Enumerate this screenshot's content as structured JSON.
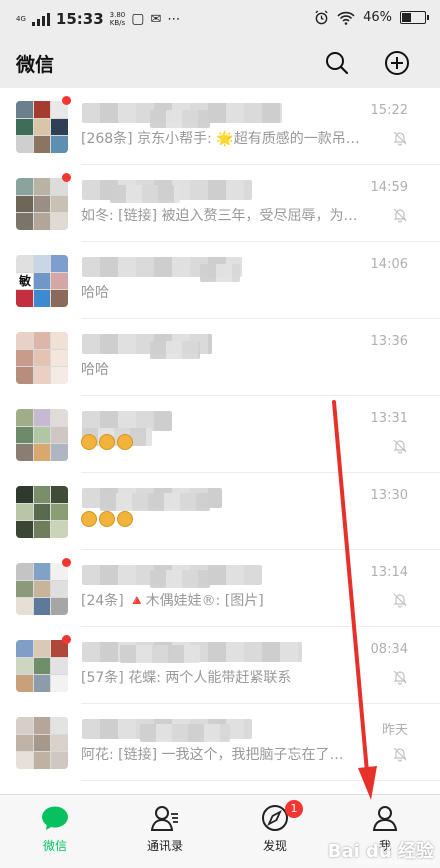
{
  "status_bar": {
    "network": "4G",
    "time": "15:33",
    "speed_value": "3.80",
    "speed_unit": "KB/s",
    "battery": "46%",
    "battery_level": 0.46
  },
  "header": {
    "title": "微信",
    "search_icon": "search-icon",
    "add_icon": "plus-circle-icon"
  },
  "chats": [
    {
      "time": "15:22",
      "preview": "[268条] 京东小帮手: 🌟超有质感的一款吊带…",
      "muted": true,
      "dot": true,
      "avatar_colors": [
        "#6b7f8f",
        "#a63c2f",
        "#e8e8e8",
        "#3e6e59",
        "#d8c6a6",
        "#2f3f56",
        "#cfcfcf",
        "#8a7563",
        "#5e8fb2"
      ]
    },
    {
      "time": "14:59",
      "preview": "如冬: [链接] 被迫入赘三年，受尽屈辱，为了…",
      "muted": true,
      "dot": true,
      "avatar_colors": [
        "#8aa39c",
        "#b9b3a3",
        "#dcdcdc",
        "#6f665a",
        "#9a8f86",
        "#c9c1b3",
        "#7a756b",
        "#b3a699",
        "#e0dbd2"
      ]
    },
    {
      "time": "14:06",
      "preview": "哈哈",
      "muted": false,
      "dot": false,
      "avatar_label": "敏",
      "avatar_colors": [
        "#e0e0e0",
        "#c8d6e6",
        "#7d9fcf",
        "#ffffff",
        "#6f98c8",
        "#d4a6a6",
        "#c32f3f",
        "#3d8ad1",
        "#8a6a58"
      ]
    },
    {
      "time": "13:36",
      "preview": "哈哈",
      "muted": false,
      "dot": false,
      "avatar_colors": [
        "#e8d2c7",
        "#dcb7a8",
        "#f0e0d6",
        "#c99b8b",
        "#e4c3b3",
        "#f4e6dd",
        "#b78e7e",
        "#e9d0c2",
        "#f5ebe4"
      ]
    },
    {
      "time": "13:31",
      "preview": "",
      "emojis": 3,
      "muted": true,
      "dot": false,
      "avatar_colors": [
        "#9fae86",
        "#c7b9d2",
        "#e0dcd8",
        "#6d8a6a",
        "#b0c6a4",
        "#cfc7c2",
        "#8a7d74",
        "#d9a86f",
        "#aeb7c1"
      ]
    },
    {
      "time": "13:30",
      "preview": "",
      "emojis": 3,
      "muted": false,
      "dot": false,
      "avatar_colors": [
        "#2e3a2b",
        "#7a8e6a",
        "#3f4d38",
        "#b7c6a4",
        "#5a6b4d",
        "#8a9e76",
        "#3a4633",
        "#6f7f5c",
        "#c9d4b8"
      ]
    },
    {
      "time": "13:14",
      "preview": "[24条] 🔺木偶娃娃®: [图片]",
      "muted": true,
      "dot": true,
      "avatar_colors": [
        "#c4c4c4",
        "#7fa3c6",
        "#f1f1f1",
        "#8b9a7b",
        "#c7b49a",
        "#dfdfdf",
        "#e6e0d4",
        "#5d7a9a",
        "#a6a6a6"
      ]
    },
    {
      "time": "08:34",
      "preview": "[57条] 花蝶: 两个人能带赶紧联系",
      "muted": true,
      "dot": true,
      "avatar_colors": [
        "#7f9ec8",
        "#d8cab4",
        "#b1473a",
        "#cdd6c1",
        "#6f8f6b",
        "#e2e2e2",
        "#c8a07a",
        "#8c9cad",
        "#f2f2f2"
      ]
    },
    {
      "time": "昨天",
      "preview": "阿花: [链接] 一我这个，我把脑子忘在了…",
      "muted": true,
      "dot": false,
      "avatar_colors": [
        "#d6cfc8",
        "#b5a699",
        "#e3e3e3",
        "#c1b3a5",
        "#a6988b",
        "#d9d2cb",
        "#e6e0d9",
        "#bfb1a3",
        "#cfc8c1"
      ]
    }
  ],
  "tabs": [
    {
      "label": "微信",
      "icon": "chat-bubble-icon",
      "active": true
    },
    {
      "label": "通讯录",
      "icon": "contacts-icon",
      "active": false
    },
    {
      "label": "发现",
      "icon": "compass-icon",
      "active": false,
      "badge": "1"
    },
    {
      "label": "我",
      "icon": "person-icon",
      "active": false
    }
  ],
  "watermark": {
    "text": "Bai du 经验",
    "sub": "jingyan.baidu.com"
  },
  "colors": {
    "accent": "#07c160",
    "badge": "#f43530",
    "arrow": "#e8302a"
  }
}
